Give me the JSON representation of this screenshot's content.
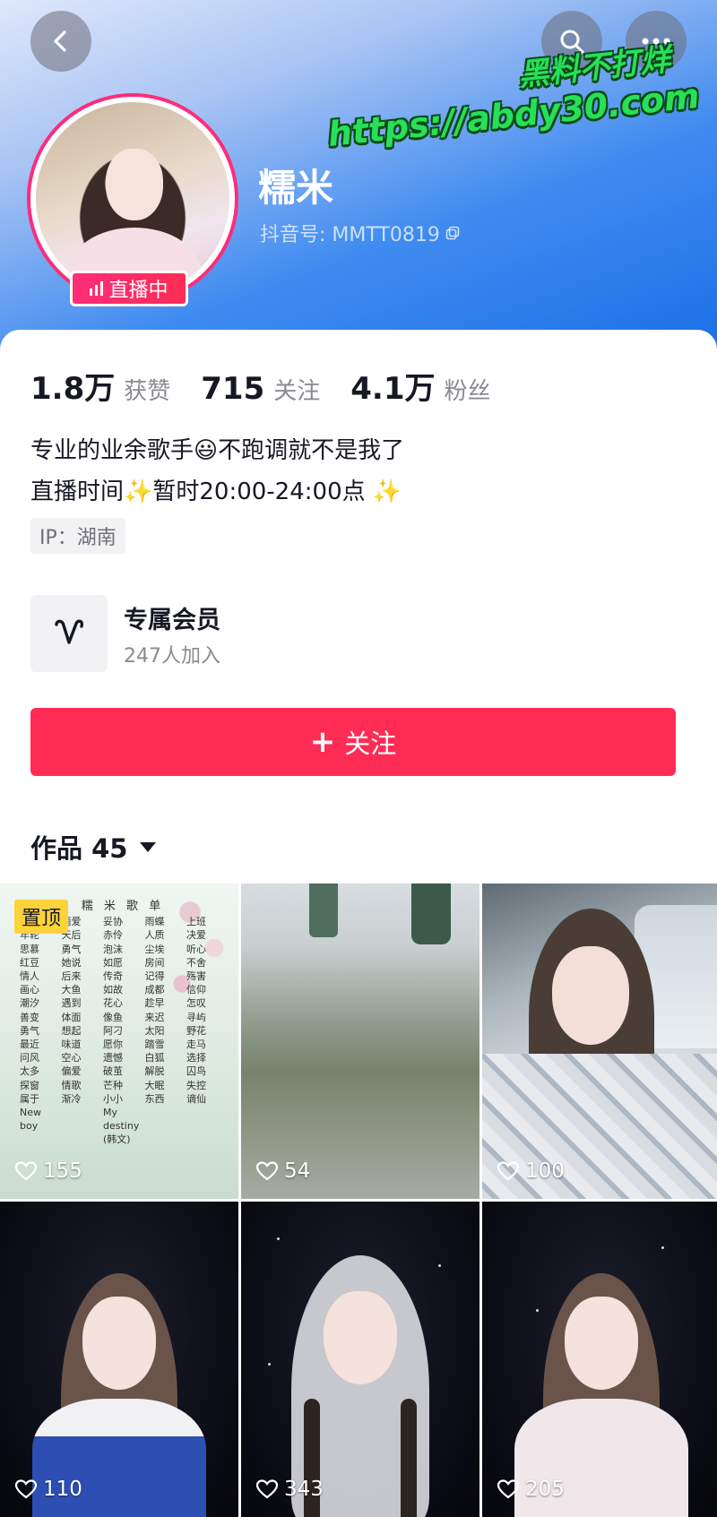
{
  "header": {
    "watermark_line1": "黑料不打烊",
    "watermark_line2": "https://abdy30.com",
    "live_label": "直播中",
    "nickname": "糯米",
    "account_id": "抖音号: MMTT0819"
  },
  "stats": [
    {
      "value": "1.8万",
      "label": "获赞"
    },
    {
      "value": "715",
      "label": "关注"
    },
    {
      "value": "4.1万",
      "label": "粉丝"
    }
  ],
  "bio": {
    "line1": "专业的业余歌手😃不跑调就不是我了",
    "line2": "直播时间✨暂时20:00-24:00点 ✨"
  },
  "ip": "IP：湖南",
  "member": {
    "title": "专属会员",
    "subtitle": "247人加入"
  },
  "follow_button": {
    "plus": "+",
    "label": "关注"
  },
  "works_tab": {
    "label": "作品 45"
  },
  "songlist": {
    "title": "糯 米 歌 单",
    "rows": [
      [
        "爱因",
        "雨爱",
        "妥协",
        "雨蝶",
        "上班"
      ],
      [
        "年轮",
        "天后",
        "赤伶",
        "人质",
        "决爱"
      ],
      [
        "思慕",
        "勇气",
        "泡沫",
        "尘埃",
        "听心"
      ],
      [
        "红豆",
        "她说",
        "如愿",
        "房间",
        "不舍"
      ],
      [
        "情人",
        "后来",
        "传奇",
        "记得",
        "殇害"
      ],
      [
        "画心",
        "大鱼",
        "如故",
        "成都",
        "信仰"
      ],
      [
        "潮汐",
        "遇到",
        "花心",
        "趁早",
        "怎叹"
      ],
      [
        "善变",
        "体面",
        "像鱼",
        "来迟",
        "寻屿"
      ],
      [
        "勇气",
        "想起",
        "阿刁",
        "太阳",
        "野花"
      ],
      [
        "最近",
        "味道",
        "愿你",
        "踏雪",
        "走马"
      ],
      [
        "问风",
        "空心",
        "遗憾",
        "白狐",
        "选择"
      ],
      [
        "太多",
        "偏爱",
        "破茧",
        "解脱",
        "囚鸟"
      ],
      [
        "探窗",
        "情歌",
        "芒种",
        "大眠",
        "失控"
      ],
      [
        "属于",
        "渐冷",
        "小小",
        "东西",
        "谪仙"
      ],
      [
        "New boy",
        "",
        "My destiny (韩文)",
        "",
        ""
      ]
    ]
  },
  "works": [
    {
      "pinned_label": "置顶",
      "likes": "155"
    },
    {
      "likes": "54"
    },
    {
      "likes": "100"
    },
    {
      "likes": "110"
    },
    {
      "likes": "343"
    },
    {
      "likes": "205"
    }
  ],
  "colors": {
    "accent": "#fe2c55",
    "live": "#fe2c7a",
    "watermark": "#27e05a",
    "pin": "#fdd33a"
  },
  "icons": {
    "back": "chevron-left-icon",
    "search": "search-icon",
    "more": "more-dots-icon",
    "member": "heart-v-icon",
    "copy": "copy-icon"
  }
}
